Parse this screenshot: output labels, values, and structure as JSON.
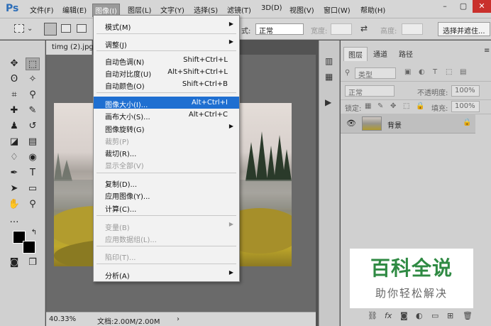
{
  "app": {
    "logo": "Ps"
  },
  "menubar": {
    "items": [
      "文件(F)",
      "编辑(E)",
      "图像(I)",
      "图层(L)",
      "文字(Y)",
      "选择(S)",
      "滤镜(T)",
      "3D(D)",
      "视图(V)",
      "窗口(W)",
      "帮助(H)"
    ],
    "active": "图像(I)",
    "window_buttons": [
      "–",
      "▢",
      "✕"
    ]
  },
  "options": {
    "style_label": "式:",
    "style_value": "正常",
    "width_label": "宽度:",
    "height_label": "高度:",
    "select_mask_button": "选择并遮住..."
  },
  "document": {
    "tab_title": "timg (2).jpg",
    "zoom": "40.33%",
    "doc_info": "文档:2.00M/2.00M"
  },
  "image_menu": {
    "items": [
      {
        "label": "模式(M)",
        "shortcut": "",
        "submenu": true,
        "disabled": false
      },
      {
        "label": "调整(J)",
        "shortcut": "",
        "submenu": true,
        "disabled": false
      },
      {
        "label": "自动色调(N)",
        "shortcut": "Shift+Ctrl+L",
        "submenu": false,
        "disabled": false
      },
      {
        "label": "自动对比度(U)",
        "shortcut": "Alt+Shift+Ctrl+L",
        "submenu": false,
        "disabled": false
      },
      {
        "label": "自动颜色(O)",
        "shortcut": "Shift+Ctrl+B",
        "submenu": false,
        "disabled": false
      },
      {
        "label": "图像大小(I)...",
        "shortcut": "Alt+Ctrl+I",
        "submenu": false,
        "disabled": false,
        "highlighted": true
      },
      {
        "label": "画布大小(S)...",
        "shortcut": "Alt+Ctrl+C",
        "submenu": false,
        "disabled": false
      },
      {
        "label": "图像旋转(G)",
        "shortcut": "",
        "submenu": true,
        "disabled": false
      },
      {
        "label": "裁剪(P)",
        "shortcut": "",
        "submenu": false,
        "disabled": true
      },
      {
        "label": "裁切(R)...",
        "shortcut": "",
        "submenu": false,
        "disabled": false
      },
      {
        "label": "显示全部(V)",
        "shortcut": "",
        "submenu": false,
        "disabled": true
      },
      {
        "label": "复制(D)...",
        "shortcut": "",
        "submenu": false,
        "disabled": false
      },
      {
        "label": "应用图像(Y)...",
        "shortcut": "",
        "submenu": false,
        "disabled": false
      },
      {
        "label": "计算(C)...",
        "shortcut": "",
        "submenu": false,
        "disabled": false
      },
      {
        "label": "变量(B)",
        "shortcut": "",
        "submenu": true,
        "disabled": true
      },
      {
        "label": "应用数据组(L)...",
        "shortcut": "",
        "submenu": false,
        "disabled": true
      },
      {
        "label": "陷印(T)...",
        "shortcut": "",
        "submenu": false,
        "disabled": true
      },
      {
        "label": "分析(A)",
        "shortcut": "",
        "submenu": true,
        "disabled": false
      }
    ]
  },
  "layers_panel": {
    "tabs": [
      "图层",
      "通道",
      "路径"
    ],
    "filter_kind": "类型",
    "blend_mode": "正常",
    "opacity_label": "不透明度:",
    "opacity_value": "100%",
    "lock_label": "锁定:",
    "fill_label": "填充:",
    "fill_value": "100%",
    "layer_name": "背景"
  },
  "watermark": {
    "title": "百科全说",
    "subtitle": "助你轻松解决"
  },
  "colors": {
    "menu_highlight": "#1f6fd1",
    "watermark_green": "#2f8a43"
  }
}
